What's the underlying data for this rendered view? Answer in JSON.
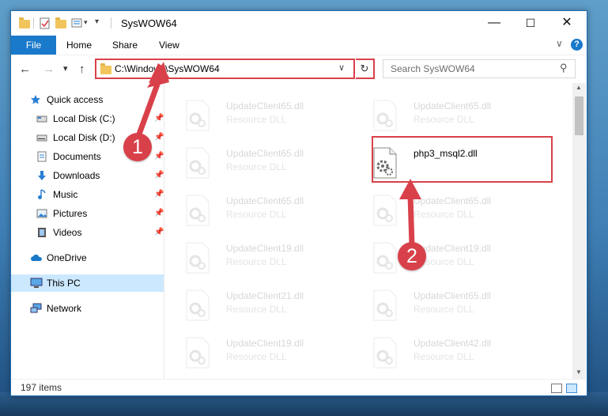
{
  "window": {
    "title": "SysWOW64",
    "min_glyph": "—",
    "max_glyph": "☐",
    "close_glyph": "✕"
  },
  "ribbon": {
    "tabs": [
      "File",
      "Home",
      "Share",
      "View"
    ]
  },
  "nav": {
    "back_glyph": "←",
    "forward_glyph": "→",
    "recent_glyph": "▾",
    "up_glyph": "↑",
    "address": "C:\\Windows\\SysWOW64",
    "address_dropdown_glyph": "∨",
    "refresh_glyph": "↻",
    "search_placeholder": "Search SysWOW64",
    "search_glyph": "⚲"
  },
  "sidebar": {
    "items": [
      {
        "label": "Quick access",
        "icon": "star-icon",
        "pinned": false
      },
      {
        "label": "Local Disk (C:)",
        "icon": "drive-icon",
        "pinned": true
      },
      {
        "label": "Local Disk (D:)",
        "icon": "drive-icon",
        "pinned": true
      },
      {
        "label": "Documents",
        "icon": "documents-icon",
        "pinned": true
      },
      {
        "label": "Downloads",
        "icon": "download-icon",
        "pinned": true
      },
      {
        "label": "Music",
        "icon": "music-icon",
        "pinned": true
      },
      {
        "label": "Pictures",
        "icon": "pictures-icon",
        "pinned": true
      },
      {
        "label": "Videos",
        "icon": "videos-icon",
        "pinned": true
      },
      {
        "label": "OneDrive",
        "icon": "cloud-icon",
        "pinned": false
      },
      {
        "label": "This PC",
        "icon": "pc-icon",
        "pinned": false,
        "selected": true
      },
      {
        "label": "Network",
        "icon": "network-icon",
        "pinned": false
      }
    ]
  },
  "files": [
    {
      "name": "UpdateClient65.dll",
      "type": "Resource DLL",
      "faded": true
    },
    {
      "name": "UpdateClient65.dll",
      "type": "Resource DLL",
      "faded": true
    },
    {
      "name": "UpdateClient65.dll",
      "type": "Resource DLL",
      "faded": true
    },
    {
      "name": "php3_msql2.dll",
      "type": "",
      "faded": false
    },
    {
      "name": "UpdateClient65.dll",
      "type": "Resource DLL",
      "faded": true
    },
    {
      "name": "UpdateClient65.dll",
      "type": "Resource DLL",
      "faded": true
    },
    {
      "name": "UpdateClient19.dll",
      "type": "Resource DLL",
      "faded": true
    },
    {
      "name": "UpdateClient19.dll",
      "type": "Resource DLL",
      "faded": true
    },
    {
      "name": "UpdateClient21.dll",
      "type": "Resource DLL",
      "faded": true
    },
    {
      "name": "UpdateClient65.dll",
      "type": "Resource DLL",
      "faded": true
    },
    {
      "name": "UpdateClient19.dll",
      "type": "Resource DLL",
      "faded": true
    },
    {
      "name": "UpdateClient42.dll",
      "type": "Resource DLL",
      "faded": true
    }
  ],
  "status": {
    "item_count": "197 items"
  },
  "callouts": [
    "1",
    "2"
  ],
  "colors": {
    "accent": "#1979ca",
    "highlight": "#d9414a"
  }
}
